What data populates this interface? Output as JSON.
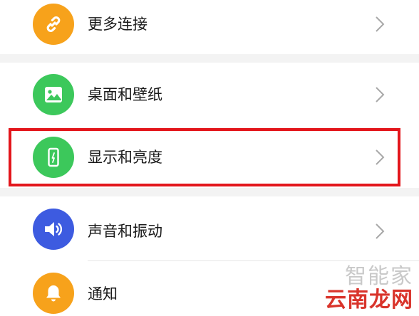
{
  "settings": {
    "items": [
      {
        "label": "更多连接",
        "icon": "link-icon",
        "color": "#F7A21B"
      },
      {
        "label": "桌面和壁纸",
        "icon": "image-icon",
        "color": "#3CC85B"
      },
      {
        "label": "显示和亮度",
        "icon": "phone-brightness-icon",
        "color": "#3CC85B"
      },
      {
        "label": "声音和振动",
        "icon": "speaker-icon",
        "color": "#3D5BE0"
      },
      {
        "label": "通知",
        "icon": "bell-icon",
        "color": "#F7A21B"
      }
    ]
  },
  "highlight_color": "#E3161C",
  "watermark": {
    "top": "智能家",
    "bottom": "云南龙网"
  }
}
